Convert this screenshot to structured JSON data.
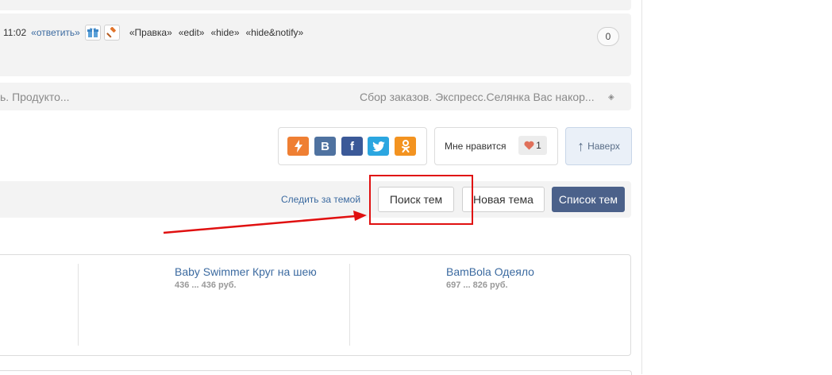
{
  "post": {
    "time": "11:02",
    "reply_label": "«ответить»",
    "links": [
      "«Правка»",
      "«edit»",
      "«hide»",
      "«hide&notify»"
    ],
    "count": "0"
  },
  "related": {
    "left_text": "ь. Продукто...",
    "right_text": "Сбор заказов. Экспресс.Селянка Вас накор...",
    "more_glyph": "◈"
  },
  "share": {
    "icons": [
      "livejournal-icon",
      "vk-icon",
      "facebook-icon",
      "twitter-icon",
      "odnoklassniki-icon"
    ],
    "vk_glyph": "В",
    "fb_glyph": "f"
  },
  "like": {
    "label": "Мне нравится",
    "count": "1",
    "heart_color": "#e0705a"
  },
  "scroll_top_label": "Наверх",
  "toolbar": {
    "follow_label": "Следить за темой",
    "search_label": "Поиск тем",
    "new_label": "Новая тема",
    "list_label": "Список тем"
  },
  "annotation_color": "#e01010",
  "products": [
    {
      "name": "Baby Swimmer Круг на шею",
      "price": "436 ... 436 руб."
    },
    {
      "name": "BamBola Одеяло",
      "price": "697 ... 826 руб."
    }
  ]
}
